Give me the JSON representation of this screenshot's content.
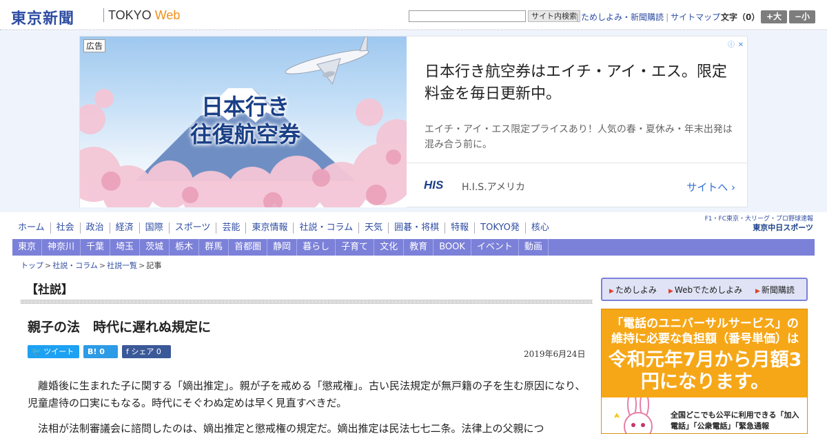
{
  "header": {
    "logo": "東京新聞",
    "logo_tokyo": "TOKYO",
    "logo_web": "Web",
    "search_placeholder": "",
    "search_button": "サイト内検索",
    "links": [
      "ためしよみ・新聞購読",
      "サイトマップ"
    ],
    "font_label": "文字（0）",
    "font_plus": "+大",
    "font_minus": "−小"
  },
  "ad": {
    "label": "広告",
    "image_headline_1": "日本行き",
    "image_headline_2": "往復航空券",
    "title": "日本行き航空券はエイチ・アイ・エス。限定料金を毎日更新中。",
    "description": "エイチ・アイ・エス限定プライスあり！人気の春・夏休み・年末出発は混み合う前に。",
    "brand_logo": "HIS",
    "advertiser": "H.I.S.アメリカ",
    "cta": "サイトへ",
    "colors": {
      "brand": "#1a3f86",
      "cta": "#2f6fd6"
    }
  },
  "nav_primary": [
    "ホーム",
    "社会",
    "政治",
    "経済",
    "国際",
    "スポーツ",
    "芸能",
    "東京情報",
    "社説・コラム",
    "天気",
    "囲碁・将棋",
    "特報",
    "TOKYO発",
    "核心"
  ],
  "chunichi": {
    "line1": "F1・FC東京・大リーグ・プロ野球速報",
    "line2": "東京中日スポーツ"
  },
  "nav_secondary": [
    "東京",
    "神奈川",
    "千葉",
    "埼玉",
    "茨城",
    "栃木",
    "群馬",
    "首都圏",
    "静岡",
    "暮らし",
    "子育て",
    "文化",
    "教育",
    "BOOK",
    "イベント",
    "動画"
  ],
  "breadcrumb": [
    "トップ",
    "社説・コラム",
    "社説一覧",
    "記事"
  ],
  "article": {
    "section": "【社説】",
    "headline": "親子の法　時代に遅れぬ規定に",
    "share_tweet": "ツイート",
    "share_hatena": "B! 0",
    "share_facebook": "シェア 0",
    "date": "2019年6月24日",
    "paragraphs": [
      "離婚後に生まれた子に関する「嫡出推定」。親が子を戒める「懲戒権」。古い民法規定が無戸籍の子を生む原因になり、児童虐待の口実にもなる。時代にそぐわぬ定めは早く見直すべきだ。",
      "法相が法制審議会に諮問したのは、嫡出推定と懲戒権の規定だ。嫡出推定は民法七七二条。法律上の父親につ"
    ]
  },
  "sidebar": {
    "links": [
      "ためしよみ",
      "Webでためしよみ",
      "新聞購読"
    ],
    "banner_top": "「電話のユニバーサルサービス」の維持に必要な負担額（番号単価）は",
    "banner_big": "令和元年7月から月額3円になります。",
    "banner_small": "全国どこでも公平に利用できる「加入電話」「公衆電話」「緊急通報"
  },
  "colors": {
    "brand_blue": "#2f4da3",
    "nav_purple": "#7b80d8",
    "banner_orange": "#f6a718"
  }
}
